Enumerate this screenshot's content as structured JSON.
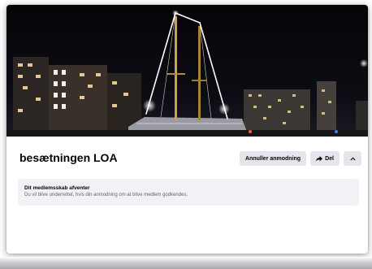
{
  "group": {
    "name": "besætningen LOA"
  },
  "actions": {
    "cancel_request_label": "Annuller anmodning",
    "share_label": "Del",
    "more_icon": "chevron-up-icon",
    "share_icon": "share-arrow-icon"
  },
  "membership_notice": {
    "title": "Dit medlemsskab afventer",
    "message": "Du vil blive underrettet, hvis din anmodning om at blive medlem godkendes."
  },
  "colors": {
    "button_bg": "#e4e6eb",
    "notice_bg": "#f0f2f5",
    "title_text": "#050505",
    "secondary_text": "#65676b"
  }
}
